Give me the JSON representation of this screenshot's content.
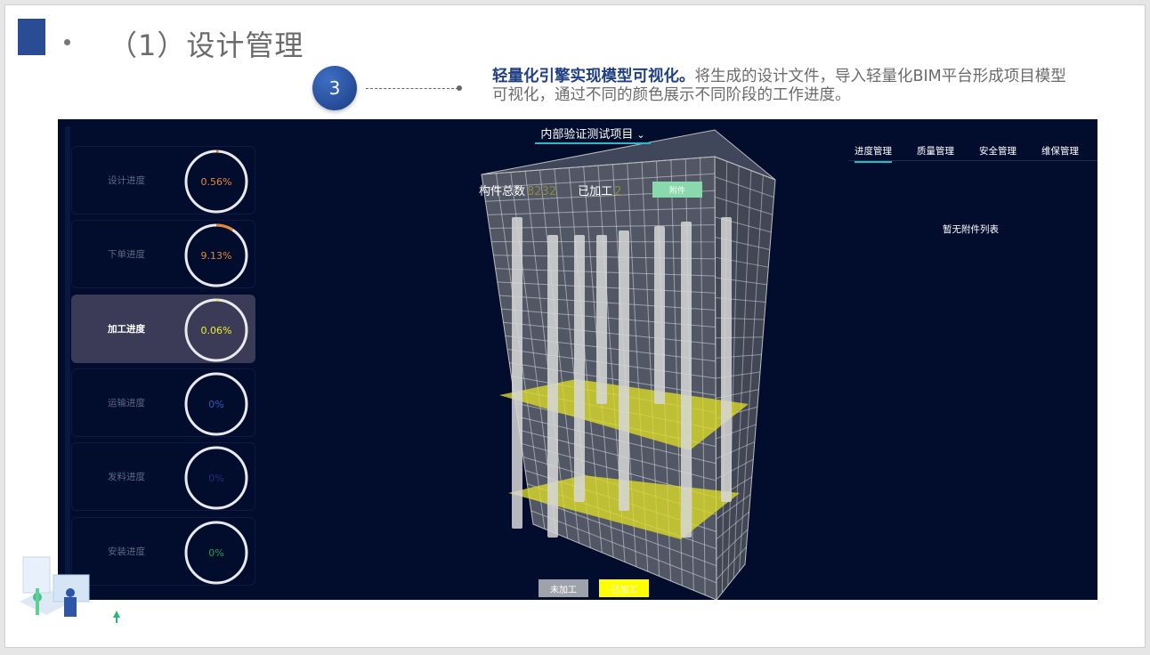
{
  "slide": {
    "title": "（1）设计管理",
    "step_number": "3",
    "step_highlight": "轻量化引擎实现模型可视化。",
    "step_text": "将生成的设计文件，导入轻量化BIM平台形成项目模型可视化，通过不同的颜色展示不同阶段的工作进度。"
  },
  "app": {
    "project_name": "内部验证测试项目",
    "progress_cards": [
      {
        "label": "设计进度",
        "value": "0.56%",
        "fraction": 0.0056,
        "color": "#e4883a"
      },
      {
        "label": "下单进度",
        "value": "9.13%",
        "fraction": 0.0913,
        "color": "#e4883a"
      },
      {
        "label": "加工进度",
        "value": "0.06%",
        "fraction": 0.0006,
        "color": "#f0ec2c"
      },
      {
        "label": "运输进度",
        "value": "0%",
        "fraction": 0,
        "color": "#2e5fb8"
      },
      {
        "label": "发料进度",
        "value": "0%",
        "fraction": 0,
        "color": "#1f2f78"
      },
      {
        "label": "安装进度",
        "value": "0%",
        "fraction": 0,
        "color": "#21a24a"
      }
    ],
    "stats": {
      "total_label": "构件总数",
      "total_value": "8232",
      "processed_label": "已加工",
      "processed_value": "2",
      "attach_button": "附件"
    },
    "legend": {
      "unprocessed": "未加工",
      "processed": "已加工"
    },
    "tabs": [
      "进度管理",
      "质量管理",
      "安全管理",
      "维保管理"
    ],
    "active_tab": 0,
    "empty_message": "暂无附件列表"
  }
}
